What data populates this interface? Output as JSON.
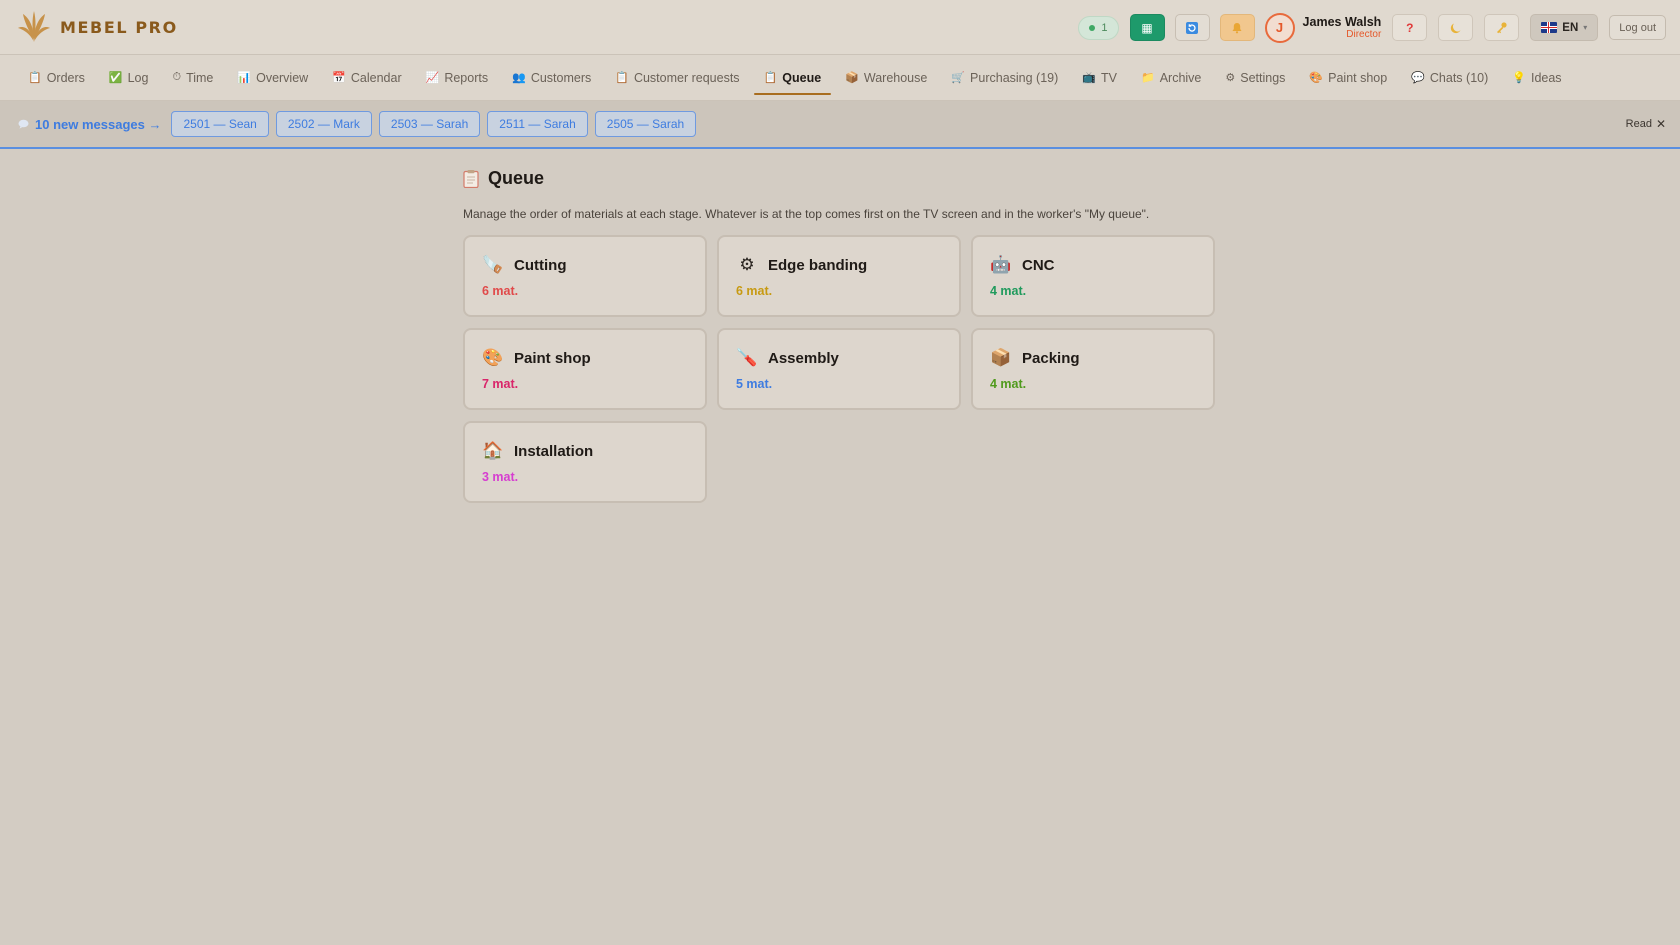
{
  "header": {
    "brand": "MEBEL PRO",
    "online_count": "1",
    "user": {
      "initial": "J",
      "name": "James Walsh",
      "role": "Director"
    },
    "help_label": "?",
    "language": "EN",
    "logout_label": "Log out"
  },
  "nav": {
    "items": [
      {
        "label": "Orders",
        "icon": "clipboard-icon"
      },
      {
        "label": "Log",
        "icon": "checkbox-icon"
      },
      {
        "label": "Time",
        "icon": "stopwatch-icon"
      },
      {
        "label": "Overview",
        "icon": "bar-chart-icon"
      },
      {
        "label": "Calendar",
        "icon": "calendar-icon"
      },
      {
        "label": "Reports",
        "icon": "line-chart-icon"
      },
      {
        "label": "Customers",
        "icon": "people-icon"
      },
      {
        "label": "Customer requests",
        "icon": "clipboard-icon"
      },
      {
        "label": "Queue",
        "icon": "clipboard-icon"
      },
      {
        "label": "Warehouse",
        "icon": "package-icon"
      },
      {
        "label": "Purchasing (19)",
        "icon": "cart-icon"
      },
      {
        "label": "TV",
        "icon": "tv-icon"
      },
      {
        "label": "Archive",
        "icon": "folder-icon"
      },
      {
        "label": "Settings",
        "icon": "gear-icon"
      },
      {
        "label": "Paint shop",
        "icon": "palette-icon"
      },
      {
        "label": "Chats (10)",
        "icon": "chat-icon"
      },
      {
        "label": "Ideas",
        "icon": "bulb-icon"
      }
    ],
    "active": "Queue"
  },
  "messages": {
    "count_label": "10 new messages →",
    "chips": [
      "2501 — Sean",
      "2502 — Mark",
      "2503 — Sarah",
      "2511 — Sarah",
      "2505 — Sarah"
    ],
    "read_label": "Read"
  },
  "main": {
    "title": "Queue",
    "description": "Manage the order of materials at each stage. Whatever is at the top comes first on the TV screen and in the worker's \"My queue\".",
    "stages": [
      {
        "name": "Cutting",
        "count": "6 mat.",
        "icon": "saw-icon",
        "color": "#e04a4a"
      },
      {
        "name": "Edge banding",
        "count": "6 mat.",
        "icon": "gear-icon",
        "color": "#c79a12"
      },
      {
        "name": "CNC",
        "count": "4 mat.",
        "icon": "robot-icon",
        "color": "#1f9a5c"
      },
      {
        "name": "Paint shop",
        "count": "7 mat.",
        "icon": "palette-icon",
        "color": "#d9266a"
      },
      {
        "name": "Assembly",
        "count": "5 mat.",
        "icon": "screwdriver-icon",
        "color": "#3e7ce0"
      },
      {
        "name": "Packing",
        "count": "4 mat.",
        "icon": "package-icon",
        "color": "#4f9a1c"
      },
      {
        "name": "Installation",
        "count": "3 mat.",
        "icon": "house-icon",
        "color": "#d63dd0"
      }
    ]
  }
}
